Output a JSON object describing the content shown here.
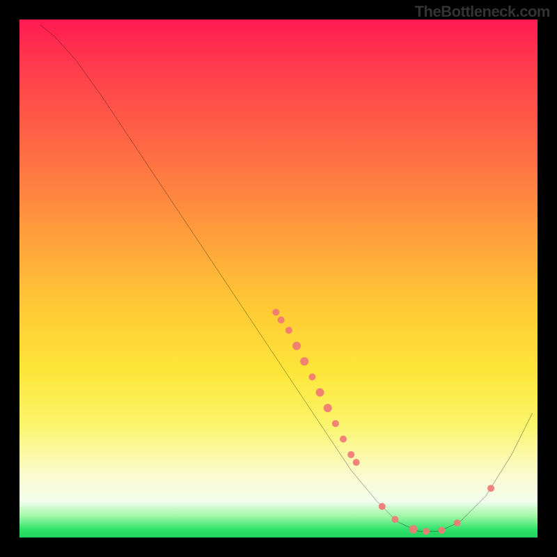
{
  "watermark": "TheBottleneck.com",
  "chart_data": {
    "type": "line",
    "title": "",
    "xlabel": "",
    "ylabel": "",
    "xlim": [
      0,
      100
    ],
    "ylim": [
      0,
      100
    ],
    "curve": [
      {
        "x": 4.0,
        "y": 99.0
      },
      {
        "x": 7.0,
        "y": 96.5
      },
      {
        "x": 11.0,
        "y": 92.0
      },
      {
        "x": 16.0,
        "y": 85.0
      },
      {
        "x": 22.0,
        "y": 76.0
      },
      {
        "x": 30.0,
        "y": 64.0
      },
      {
        "x": 38.0,
        "y": 52.0
      },
      {
        "x": 46.0,
        "y": 40.0
      },
      {
        "x": 52.0,
        "y": 31.0
      },
      {
        "x": 58.0,
        "y": 22.0
      },
      {
        "x": 64.0,
        "y": 13.0
      },
      {
        "x": 69.0,
        "y": 7.0
      },
      {
        "x": 73.0,
        "y": 3.0
      },
      {
        "x": 77.0,
        "y": 1.2
      },
      {
        "x": 81.0,
        "y": 1.2
      },
      {
        "x": 85.0,
        "y": 3.0
      },
      {
        "x": 90.0,
        "y": 8.0
      },
      {
        "x": 95.0,
        "y": 16.0
      },
      {
        "x": 99.0,
        "y": 24.0
      }
    ],
    "markers": [
      {
        "x": 49.5,
        "y": 43.5,
        "r": 5
      },
      {
        "x": 50.5,
        "y": 42.0,
        "r": 5
      },
      {
        "x": 52.0,
        "y": 40.0,
        "r": 5
      },
      {
        "x": 53.5,
        "y": 37.0,
        "r": 6
      },
      {
        "x": 55.0,
        "y": 34.0,
        "r": 6
      },
      {
        "x": 56.5,
        "y": 31.0,
        "r": 5
      },
      {
        "x": 58.0,
        "y": 28.0,
        "r": 6
      },
      {
        "x": 59.5,
        "y": 25.0,
        "r": 6
      },
      {
        "x": 61.0,
        "y": 22.0,
        "r": 5
      },
      {
        "x": 62.5,
        "y": 19.0,
        "r": 5
      },
      {
        "x": 64.0,
        "y": 16.0,
        "r": 5
      },
      {
        "x": 65.0,
        "y": 14.5,
        "r": 5
      },
      {
        "x": 70.0,
        "y": 6.0,
        "r": 5
      },
      {
        "x": 72.5,
        "y": 3.5,
        "r": 5
      },
      {
        "x": 76.0,
        "y": 1.6,
        "r": 6
      },
      {
        "x": 78.5,
        "y": 1.2,
        "r": 5
      },
      {
        "x": 81.5,
        "y": 1.4,
        "r": 5
      },
      {
        "x": 84.5,
        "y": 2.8,
        "r": 5
      },
      {
        "x": 91.0,
        "y": 9.5,
        "r": 5
      }
    ],
    "marker_color": "#f07875",
    "line_color": "#000000"
  }
}
